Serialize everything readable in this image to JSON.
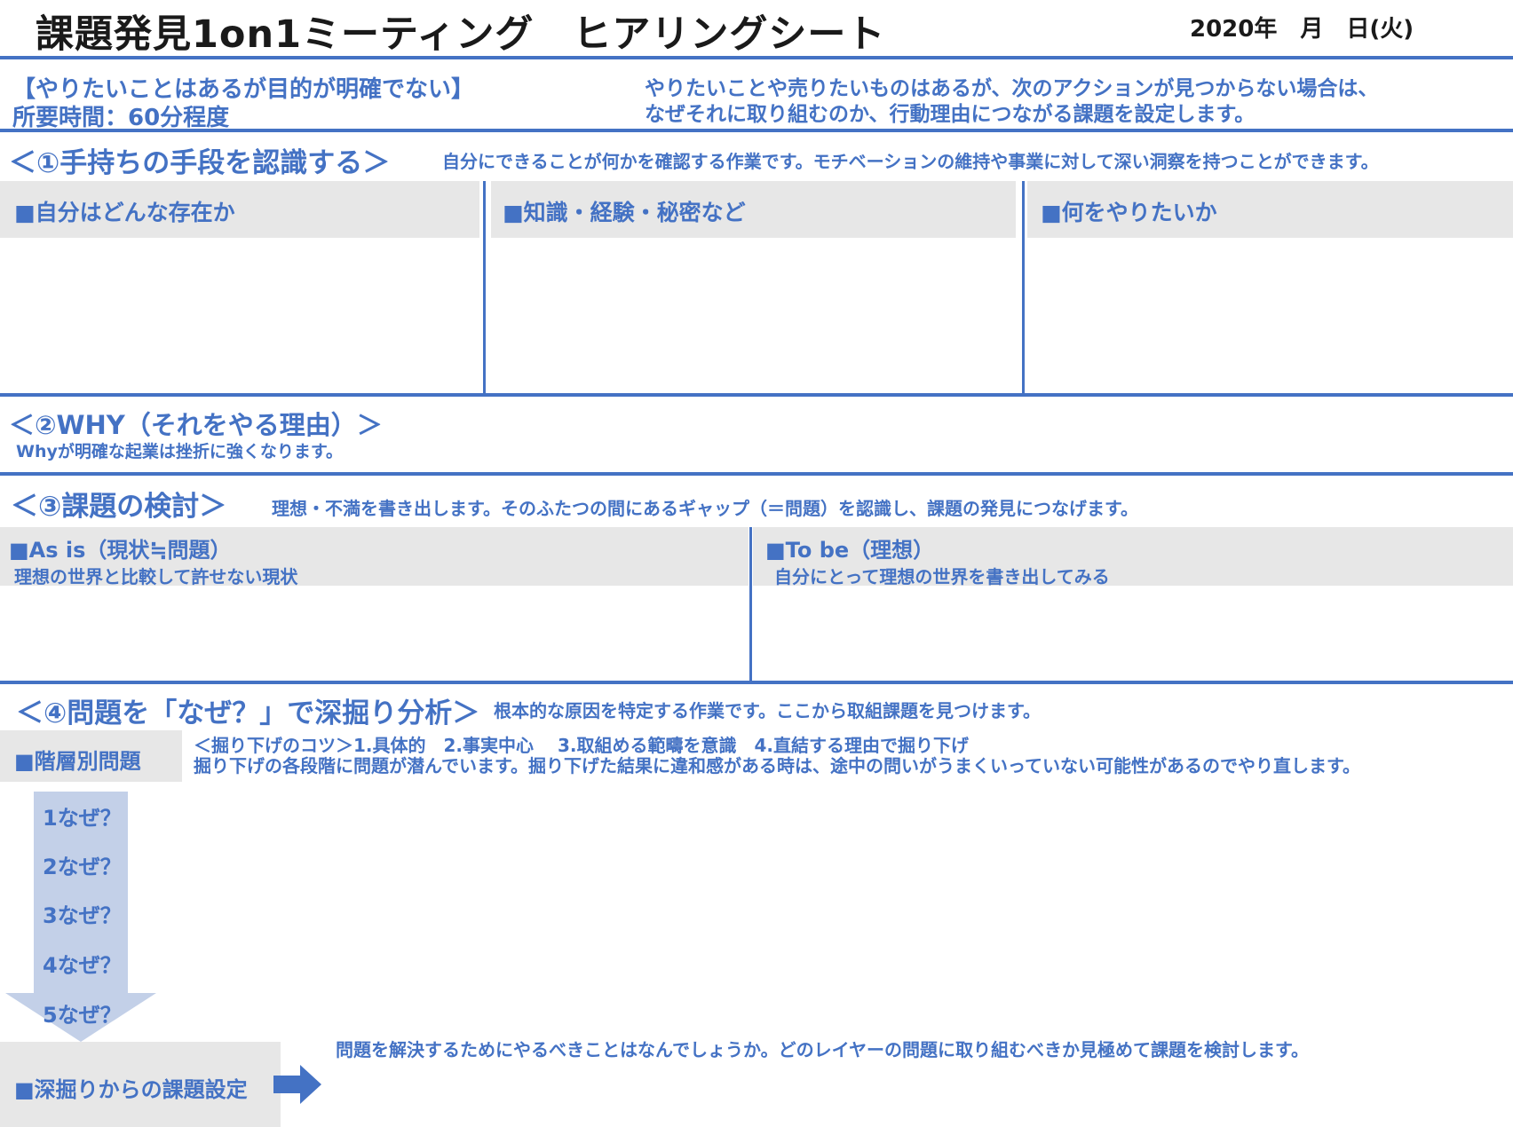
{
  "header": {
    "title": "課題発見1on1ミーティング　ヒアリングシート",
    "date": "2020年　月　日(火)"
  },
  "intro": {
    "category": "【やりたいことはあるが目的が明確でない】",
    "duration": "所要時間：60分程度",
    "description_line1": "やりたいことや売りたいものはあるが、次のアクションが見つからない場合は、",
    "description_line2": "なぜそれに取り組むのか、行動理由につながる課題を設定します。"
  },
  "section1": {
    "heading": "＜①手持ちの手段を認識する＞",
    "description": "自分にできることが何かを確認する作業です。モチベーションの維持や事業に対して深い洞察を持つことができます。",
    "col1_label": "■自分はどんな存在か",
    "col2_label": "■知識・経験・秘密など",
    "col3_label": "■何をやりたいか"
  },
  "section2": {
    "heading": "＜②WHY（それをやる理由）＞",
    "description": "Whyが明確な起業は挫折に強くなります。"
  },
  "section3": {
    "heading": "＜③課題の検討＞",
    "description": "理想・不満を書き出します。そのふたつの間にあるギャップ（＝問題）を認識し、課題の発見につなげます。",
    "asis_label": "■As is（現状≒問題）",
    "asis_sub": "理想の世界と比較して許せない現状",
    "tobe_label": "■To be（理想）",
    "tobe_sub": "自分にとって理想の世界を書き出してみる"
  },
  "section4": {
    "heading": "＜④問題を「なぜ？」で深掘り分析＞",
    "description": "根本的な原因を特定する作業です。ここから取組課題を見つけます。",
    "layer_label": "■階層別問題",
    "tips_line1": "＜掘り下げのコツ＞1.具体的　2.事実中心　 3.取組める範疇を意識　4.直結する理由で掘り下げ",
    "tips_line2": "掘り下げの各段階に問題が潜んでいます。掘り下げた結果に違和感がある時は、途中の問いがうまくいっていない可能性があるのでやり直します。",
    "whys": [
      "1なぜ？",
      "2なぜ？",
      "3なぜ？",
      "4なぜ？",
      "5なぜ？"
    ],
    "setting_label": "■深掘りからの課題設定",
    "setting_description": "問題を解決するためにやるべきことはなんでしょうか。どのレイヤーの問題に取り組むべきか見極めて課題を検討します。"
  },
  "colors": {
    "accent": "#4472C4",
    "title": "#1a1a1a",
    "panel": "#e7e7e7",
    "arrow": "#c3d0e8"
  }
}
